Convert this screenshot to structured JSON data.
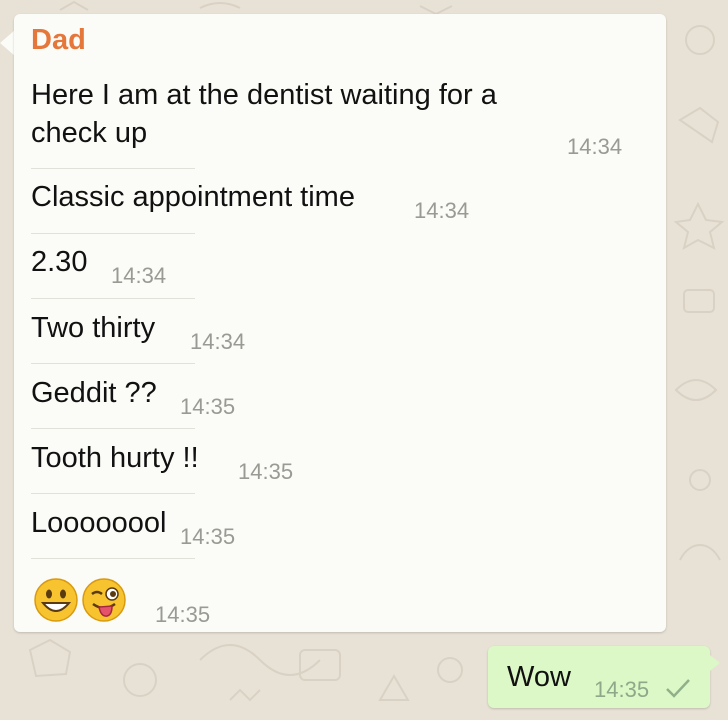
{
  "chat": {
    "sender": "Dad",
    "messages": [
      {
        "text": "Here I am at the dentist waiting for a",
        "text2": "check up",
        "time": "14:34"
      },
      {
        "text": "Classic appointment time",
        "time": "14:34"
      },
      {
        "text": "2.30",
        "time": "14:34"
      },
      {
        "text": "Two thirty",
        "time": "14:34"
      },
      {
        "text": "Geddit ??",
        "time": "14:35"
      },
      {
        "text": "Tooth hurty !!",
        "time": "14:35"
      },
      {
        "text": "Loooooool",
        "time": "14:35"
      },
      {
        "emojis": [
          "grinning-face-emoji",
          "winking-face-tongue-emoji"
        ],
        "time": "14:35"
      }
    ],
    "outgoing": {
      "text": "Wow",
      "time": "14:35",
      "status": "sent-check-icon"
    }
  },
  "colors": {
    "sender_name": "#e5773b",
    "incoming_bubble": "#fbfbf7",
    "outgoing_bubble": "#dcf8c6",
    "wallpaper": "#e8e2d6",
    "timestamp": "#9a9a94"
  }
}
